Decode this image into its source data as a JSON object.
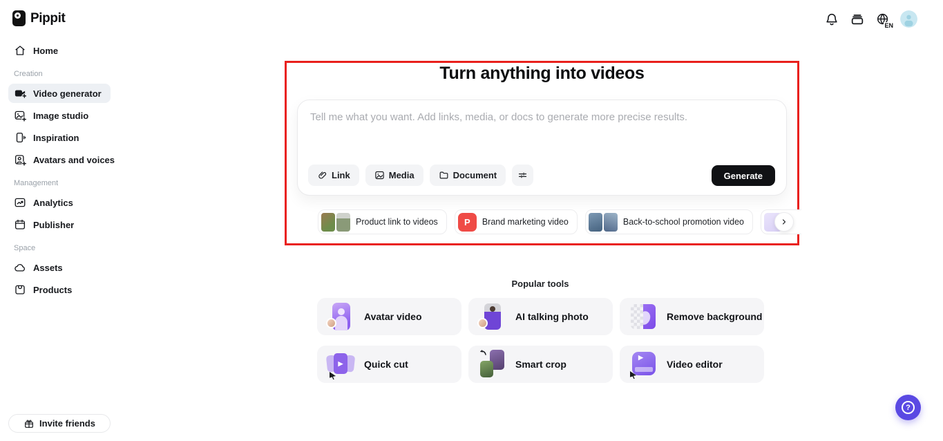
{
  "brand": {
    "name": "Pippit"
  },
  "topbar": {
    "language": "EN",
    "icons": [
      "notification-bell-icon",
      "card-stack-icon",
      "globe-language-icon",
      "user-avatar"
    ]
  },
  "sidebar": {
    "home": {
      "label": "Home"
    },
    "sections": [
      {
        "label": "Creation",
        "items": [
          {
            "label": "Video generator",
            "icon": "video-plus-icon",
            "active": true
          },
          {
            "label": "Image studio",
            "icon": "image-plus-icon",
            "active": false
          },
          {
            "label": "Inspiration",
            "icon": "inspiration-icon",
            "active": false
          },
          {
            "label": "Avatars and voices",
            "icon": "avatar-card-icon",
            "active": false
          }
        ]
      },
      {
        "label": "Management",
        "items": [
          {
            "label": "Analytics",
            "icon": "analytics-chart-icon",
            "active": false
          },
          {
            "label": "Publisher",
            "icon": "calendar-icon",
            "active": false
          }
        ]
      },
      {
        "label": "Space",
        "items": [
          {
            "label": "Assets",
            "icon": "cloud-icon",
            "active": false
          },
          {
            "label": "Products",
            "icon": "product-bag-icon",
            "active": false
          }
        ]
      }
    ],
    "invite": {
      "label": "Invite friends",
      "icon": "gift-icon"
    }
  },
  "hero": {
    "title": "Turn anything into videos",
    "input_placeholder": "Tell me what you want. Add links, media, or docs to generate more precise results.",
    "attach_buttons": [
      {
        "label": "Link",
        "icon": "paperclip-icon"
      },
      {
        "label": "Media",
        "icon": "image-icon"
      },
      {
        "label": "Document",
        "icon": "folder-icon"
      }
    ],
    "settings_icon": "sliders-icon",
    "generate_label": "Generate",
    "suggestions": [
      {
        "label": "Product link to videos"
      },
      {
        "label": "Brand marketing video",
        "badge": "P"
      },
      {
        "label": "Back-to-school promotion video"
      }
    ]
  },
  "popular_tools": {
    "title": "Popular tools",
    "tools": [
      {
        "label": "Avatar video"
      },
      {
        "label": "AI talking photo"
      },
      {
        "label": "Remove background"
      },
      {
        "label": "Quick cut"
      },
      {
        "label": "Smart crop"
      },
      {
        "label": "Video editor"
      }
    ]
  },
  "colors": {
    "highlight_red": "#E9201C",
    "brand_black": "#111111",
    "generate_black": "#101114",
    "active_item_bg": "#EDF0F4",
    "tile_bg": "#F5F5F7",
    "badge_red": "#EF4B46",
    "help_purple": "#5A49E3",
    "avatar_bg": "#C8E7F1"
  }
}
